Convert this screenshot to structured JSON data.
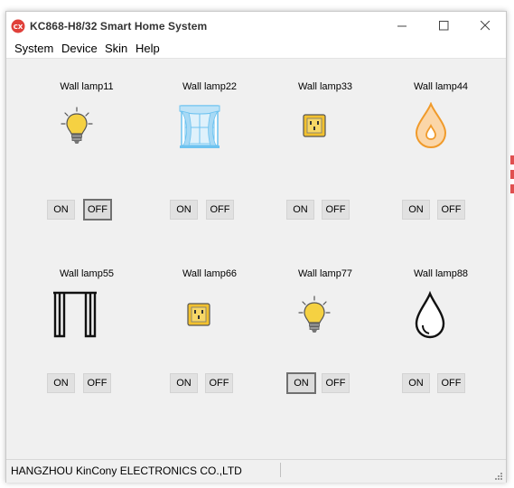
{
  "window": {
    "title": "KC868-H8/32 Smart Home System",
    "app_icon_text": "CX"
  },
  "menu": {
    "system": "System",
    "device": "Device",
    "skin": "Skin",
    "help": "Help"
  },
  "lamps": [
    {
      "label": "Wall lamp11",
      "icon": "bulb-icon",
      "on": "ON",
      "off": "OFF",
      "active": "off"
    },
    {
      "label": "Wall lamp22",
      "icon": "window-curtain-icon",
      "on": "ON",
      "off": "OFF",
      "active": "none"
    },
    {
      "label": "Wall lamp33",
      "icon": "socket-icon",
      "on": "ON",
      "off": "OFF",
      "active": "none"
    },
    {
      "label": "Wall lamp44",
      "icon": "water-drop-icon",
      "on": "ON",
      "off": "OFF",
      "active": "none"
    },
    {
      "label": "Wall lamp55",
      "icon": "curtain-icon",
      "on": "ON",
      "off": "OFF",
      "active": "none"
    },
    {
      "label": "Wall lamp66",
      "icon": "socket-icon",
      "on": "ON",
      "off": "OFF",
      "active": "none"
    },
    {
      "label": "Wall lamp77",
      "icon": "bulb-icon",
      "on": "ON",
      "off": "OFF",
      "active": "on"
    },
    {
      "label": "Wall lamp88",
      "icon": "water-drop-outline-icon",
      "on": "ON",
      "off": "OFF",
      "active": "none"
    }
  ],
  "status": {
    "company": "HANGZHOU KinCony ELECTRONICS CO.,LTD"
  },
  "colors": {
    "bulb": "#f5d142",
    "socket": "#f2c12e",
    "curtain_blue": "#6ec3f0",
    "drop_orange": "#f09a2a",
    "app_icon_red": "#e0403a"
  }
}
